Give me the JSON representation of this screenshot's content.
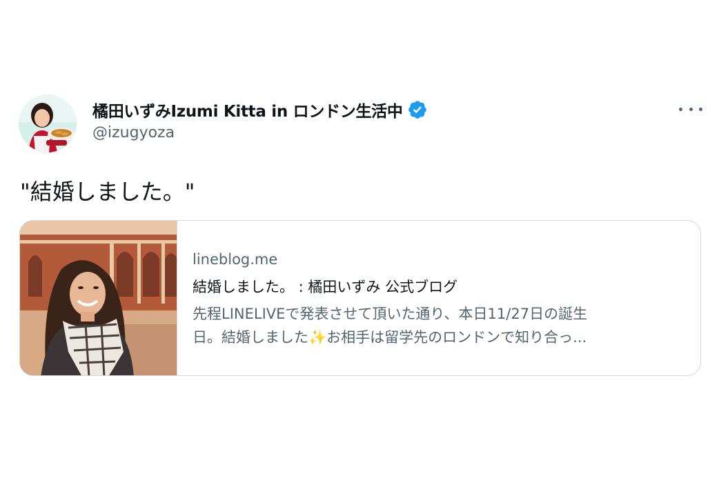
{
  "tweet": {
    "author": {
      "display_name": "橘田いずみIzumi Kitta in ロンドン生活中",
      "handle": "@izugyoza",
      "verified": true,
      "avatar_icon": "profile-photo"
    },
    "more_icon": "ellipsis-icon",
    "text": "\"結婚しました。\""
  },
  "card": {
    "domain": "lineblog.me",
    "title": "結婚しました。 : 橘田いずみ 公式ブログ",
    "description_line1": "先程LINELIVEで発表させて頂いた通り、本日11/27日の誕生",
    "description_line2": "日。結婚しました✨お相手は留学先のロンドンで知り合っ...",
    "image_icon": "article-thumbnail"
  },
  "colors": {
    "text_primary": "#0f1419",
    "text_secondary": "#536471",
    "verified_blue": "#1d9bf0",
    "border": "#cfd9de"
  }
}
